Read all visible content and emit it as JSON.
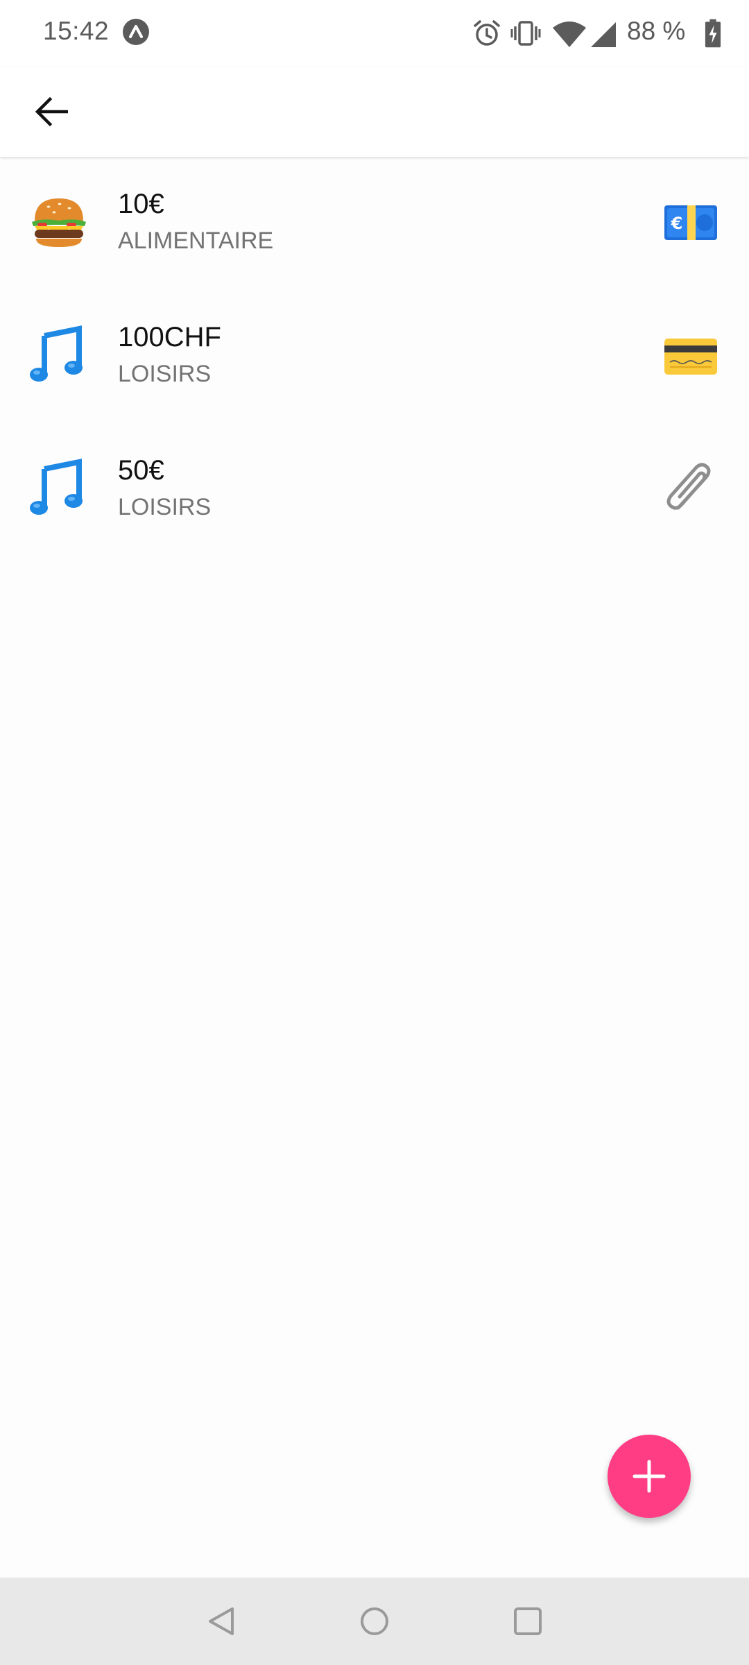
{
  "status_bar": {
    "time": "15:42",
    "battery_text": "88 %",
    "icons": [
      "app-notification-icon",
      "alarm-icon",
      "vibrate-icon",
      "wifi-icon",
      "signal-icon",
      "battery-charging-icon"
    ]
  },
  "app_bar": {
    "back_icon": "arrow-left-icon"
  },
  "expenses": [
    {
      "amount": "10€",
      "category": "ALIMENTAIRE",
      "category_icon": "hamburger-icon",
      "payment_icon": "euro-banknote-icon"
    },
    {
      "amount": "100CHF",
      "category": "LOISIRS",
      "category_icon": "music-note-icon",
      "payment_icon": "credit-card-icon"
    },
    {
      "amount": "50€",
      "category": "LOISIRS",
      "category_icon": "music-note-icon",
      "payment_icon": "paperclip-icon"
    }
  ],
  "fab": {
    "icon": "plus-icon",
    "color": "#ff3d84"
  },
  "nav_bar": {
    "icons": [
      "back-triangle-icon",
      "home-circle-icon",
      "recents-square-icon"
    ]
  }
}
